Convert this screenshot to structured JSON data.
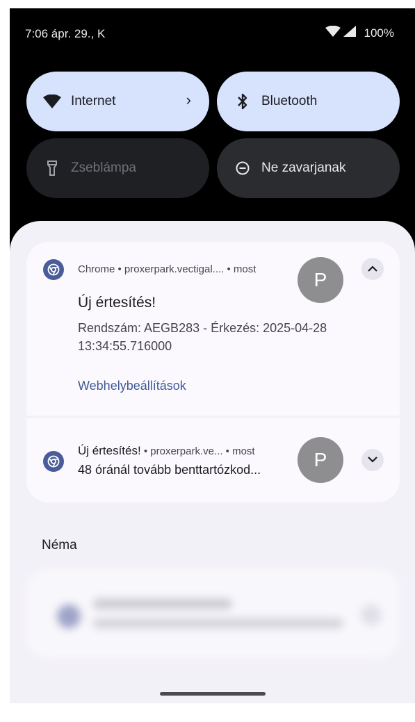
{
  "status_bar": {
    "time_date": "7:06 ápr. 29., K",
    "battery": "100%",
    "icons": [
      "wifi-icon",
      "cell-signal-icon"
    ]
  },
  "quick_settings": {
    "internet": {
      "label": "Internet",
      "state": "on",
      "icon": "wifi-icon"
    },
    "bluetooth": {
      "label": "Bluetooth",
      "state": "on",
      "icon": "bluetooth-icon"
    },
    "flashlight": {
      "label": "Zseblámpa",
      "state": "off",
      "icon": "flashlight-icon"
    },
    "dnd": {
      "label": "Ne zavarjanak",
      "state": "off",
      "icon": "dnd-icon"
    }
  },
  "notifications": [
    {
      "header": "Chrome • proxerpark.vectigal.... • most",
      "avatar_letter": "P",
      "title": "Új értesítés!",
      "body": "Rendszám: AEGB283 - Érkezés: 2025-04-28 13:34:55.716000",
      "action": "Webhelybeállítások",
      "expanded": true
    },
    {
      "title": "Új értesítés!",
      "header_suffix": " • proxerpark.ve... • most",
      "body": "48 óránál tovább benttartózkod...",
      "avatar_letter": "P",
      "expanded": false
    }
  ],
  "silent_section": {
    "label": "Néma"
  },
  "colors": {
    "tile_on": "#d7e3fc",
    "shade_bg": "#f3f1f8",
    "card_bg": "#fbf9fe",
    "chrome_icon": "#4a5d9a",
    "link": "#3f5a95"
  }
}
